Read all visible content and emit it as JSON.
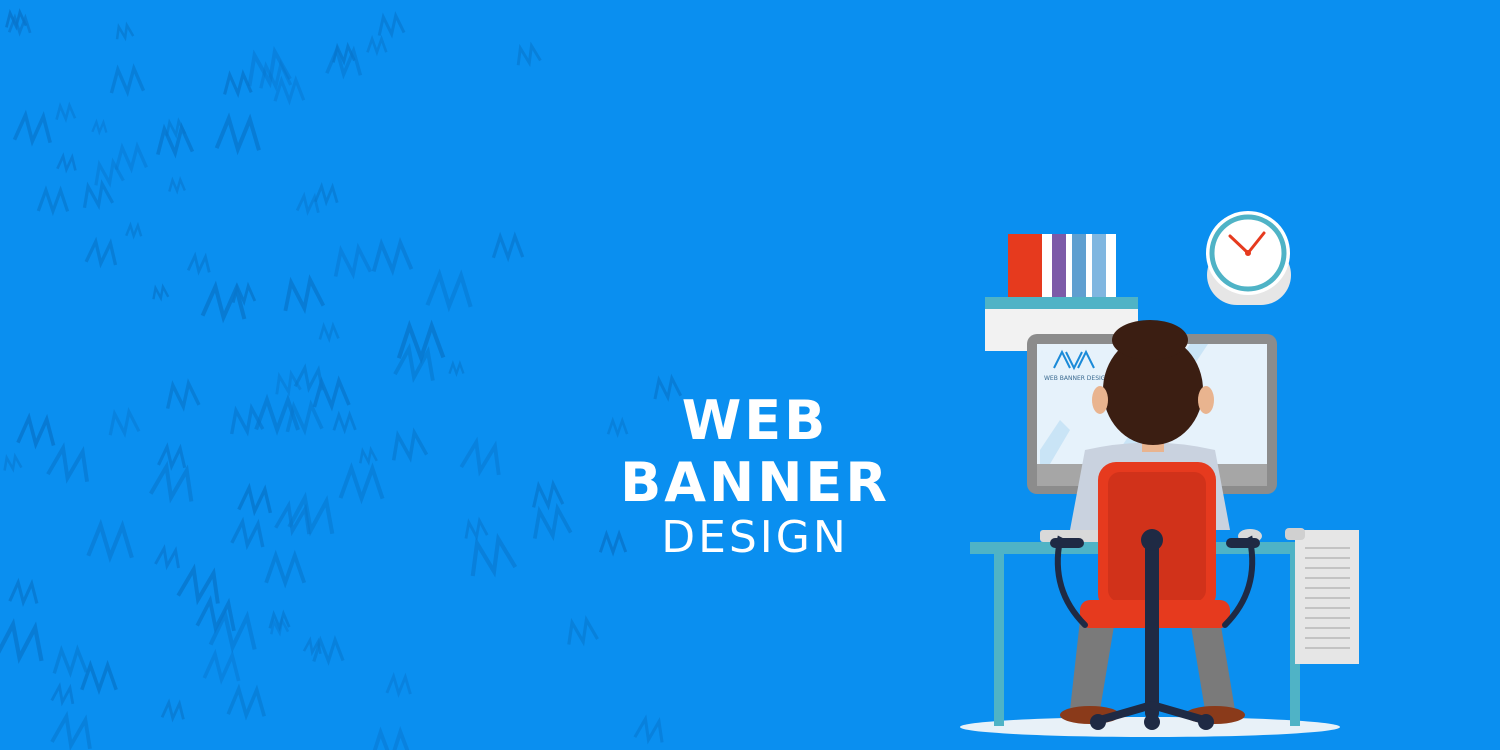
{
  "headline": {
    "line1": "WEB BANNER",
    "line2": "DESIGN"
  },
  "monitor_screen": {
    "logo_text": "AVA",
    "caption": "WEB BANNER DESIGN"
  },
  "background_logo_mark": "AVA",
  "colors": {
    "background": "#0a8ff0",
    "pattern": "#0876cc",
    "chair": "#e63a1e",
    "desk": "#4fb3c6",
    "monitor": "#8c8c8c",
    "hair": "#3b1e12"
  },
  "icons": [
    "ava-logo-icon",
    "clock-icon",
    "books-icon",
    "printer-paper-icon"
  ]
}
